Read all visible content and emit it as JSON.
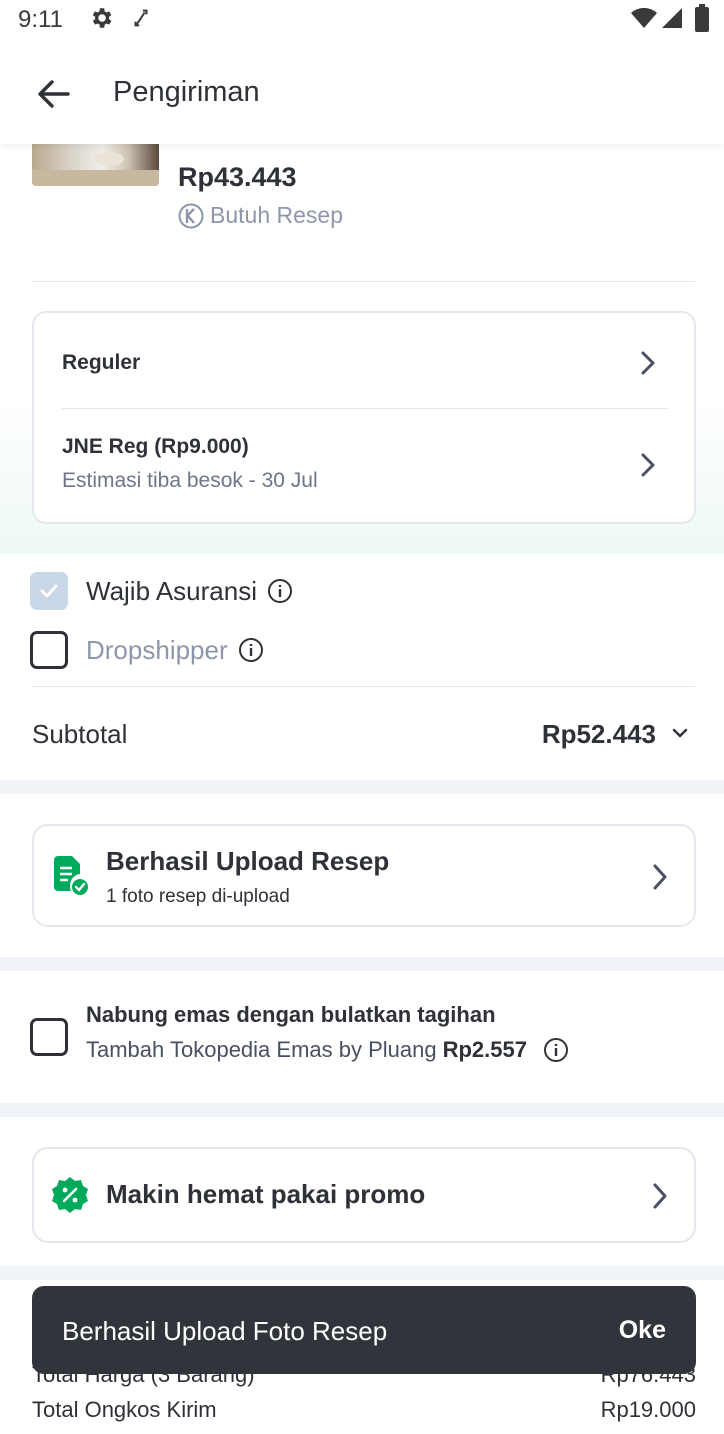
{
  "status_bar": {
    "time": "9:11",
    "icons": [
      "gear-icon",
      "sync-icon",
      "wifi-icon",
      "signal-icon",
      "battery-icon"
    ]
  },
  "app_bar": {
    "title": "Pengiriman",
    "back_icon": "arrow-left-icon"
  },
  "product": {
    "price": "Rp43.443",
    "prescription_label": "Butuh Resep",
    "prescription_icon": "k-circle-icon"
  },
  "shipping": {
    "service": "Reguler",
    "courier": "JNE Reg (Rp9.000)",
    "estimate": "Estimasi tiba besok - 30 Jul"
  },
  "options": {
    "insurance_label": "Wajib Asuransi",
    "insurance_checked": true,
    "dropshipper_label": "Dropshipper",
    "dropshipper_checked": false
  },
  "subtotal": {
    "label": "Subtotal",
    "value": "Rp52.443"
  },
  "prescription_upload": {
    "title": "Berhasil Upload Resep",
    "subtitle": "1 foto resep di-upload",
    "icon": "document-check-icon"
  },
  "gold_savings": {
    "title": "Nabung emas dengan bulatkan tagihan",
    "subtitle": "Tambah Tokopedia Emas by Pluang",
    "amount": "Rp2.557",
    "checked": false
  },
  "promo": {
    "title": "Makin hemat pakai promo",
    "icon": "discount-badge-icon"
  },
  "summary": {
    "total_price_label": "Total Harga (3 Barang)",
    "total_price_value": "Rp76.443",
    "shipping_label": "Total Ongkos Kirim",
    "shipping_value": "Rp19.000"
  },
  "snackbar": {
    "message": "Berhasil Upload Foto Resep",
    "action": "Oke"
  },
  "colors": {
    "accent_green": "#00AA5B",
    "text_primary": "#2E3137",
    "snackbar_bg": "#31353B",
    "checkbox_checked": "#C9D6E8"
  }
}
